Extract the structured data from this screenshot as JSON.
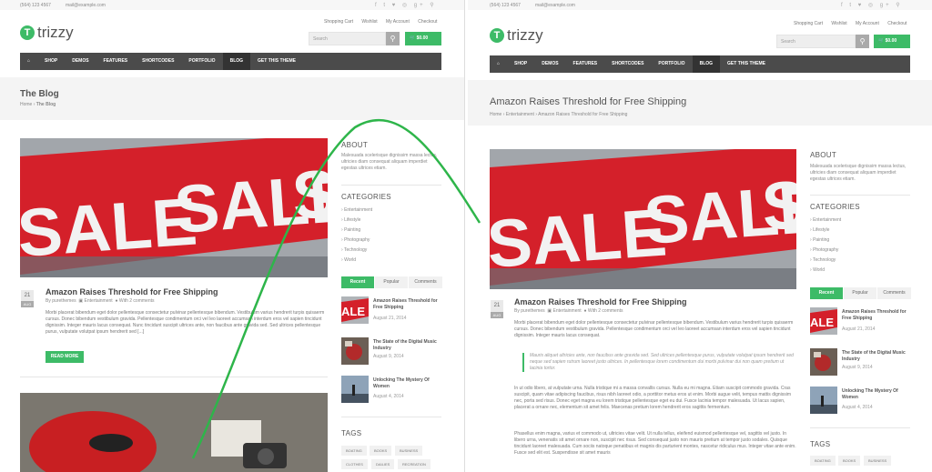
{
  "topbar": {
    "phone": "(564) 123 4567",
    "email": "mail@example.com",
    "social": "f t ♥ ◎ g+ ⚲"
  },
  "usermenu": {
    "cart": "Shopping Cart",
    "wishlist": "Wishlist",
    "account": "My Account",
    "checkout": "Checkout"
  },
  "logo": {
    "mark": "T",
    "text": "trizzy"
  },
  "search": {
    "placeholder": "Search",
    "icon": "magnifier-icon"
  },
  "cart_total": "$0.00",
  "nav": [
    "⌂",
    "SHOP",
    "DEMOS",
    "FEATURES",
    "SHORTCODES",
    "PORTFOLIO",
    "BLOG",
    "GET THIS THEME"
  ],
  "left": {
    "title": "The Blog",
    "crumb_home": "Home",
    "crumb_sep": "›",
    "crumb_current": "The Blog",
    "post": {
      "day": "21",
      "month": "AUG",
      "title": "Amazon Raises Threshold for Free Shipping",
      "author": "By purethemes",
      "category": "Entertainment",
      "comments": "With 2 comments",
      "excerpt": "Morbi placerat bibendum eget dolor pellentesque consectetur pulvinar pellentesque bibendum. Vestibulum varius hendrerit turpis quisaerm cursus. Donec bibendum vestibulum gravida. Pellentesque condimentum orci vel leo laoreet accumsan interdum eros vel sapien tincidunt dignissim. Integer mauris lacus consequat. Nunc tincidunt suscipit ultrices ante, non faucibus ante gravida sed. Sed ultrices pellentesque purus, vulputate volutpat ipsum hendrerit sed [...]",
      "read_more": "READ MORE"
    }
  },
  "right": {
    "title": "Amazon Raises Threshold for Free Shipping",
    "crumb_home": "Home",
    "crumb_sep": "›",
    "crumb_mid": "Entertainment",
    "crumb_current": "Amazon Raises Threshold for Free Shipping",
    "post": {
      "day": "21",
      "month": "AUG",
      "title": "Amazon Raises Threshold for Free Shipping",
      "author": "By purethemes",
      "category": "Entertainment",
      "comments": "With 2 comments",
      "p1": "Morbi placerat bibendum eget dolor pellentesque consectetur pulvinar pellentesque bibendum. Vestibulum varius hendrerit turpis quisaerm cursus. Donec bibendum vestibulum gravida. Pellentesque condimentum orci vel leo laoreet accumsan interdum eros vel sapien tincidunt dignissim. Integer mauris lacus consequat.",
      "quote": "Mauris aliquet ultricies ante, non faucibus ante gravida sed. Sed ultrices pellentesque purus, vulputate volutpat ipsum hendrerit sed neque sed sapien rutrum laoreet justo ultrices. In pellentesque lorem condimentum dui morbi pulvinar dui non quam pretium ut lacinia tortor.",
      "p2": "In ut odio libero, at vulputate urna. Nulla tristique mi a massa convallis cursus. Nulla eu mi magna. Etiam suscipit commodo gravida. Cras suscipit, quam vitae adipiscing faucibus, risus nibh laoreet odio, a porttitor metus eros ut enim. Morbi augue velit, tempus mattis dignissim nec, porta sed risus. Donec eget magna eu lorem tristique pellentesque eget eu dui. Fusce lacinia tempor malesuada. Ut lacus sapien, placerat a ornare nec, elementum sit amet felis. Maecenas pretium lorem hendrerit eros sagittis fermentum.",
      "p3": "Phasellus enim magna, varius et commodo ut, ultricies vitae velit. Ut nulla tellus, eleifend euismod pellentesque vel, sagittis vel justo. In libero urna, venenatis sit amet ornare non, suscipit nec risus. Sed consequat justo non mauris pretium at tempor justo sodales. Quisque tincidunt laoreet malesuada. Cum sociis natoque penatibus et magnis dis parturient montes, nascetur ridiculus mus. Integer vitae ante enim. Fusce sed elit est. Suspendisse sit amet mauris"
    }
  },
  "sidebar": {
    "about_title": "ABOUT",
    "about_text": "Malesuada scelerisque dignissim massa lectus, ultricies diam consequat aliquam imperdiet egestas ultrices etiam.",
    "cat_title": "CATEGORIES",
    "categories": [
      "Entertainment",
      "Lifestyle",
      "Painting",
      "Photography",
      "Technology",
      "World"
    ],
    "tabs": [
      "Recent",
      "Popular",
      "Comments"
    ],
    "recent": [
      {
        "title": "Amazon Raises Threshold for Free Shipping",
        "date": "August 21, 2014"
      },
      {
        "title": "The State of the Digital Music Industry",
        "date": "August 9, 2014"
      },
      {
        "title": "Unlocking The Mystery Of Women",
        "date": "August 4, 2014"
      }
    ],
    "tags_title": "TAGS",
    "tags": [
      "BOATING",
      "BOOKS",
      "BUSINESS",
      "CLOTHES",
      "DAILIES",
      "RECREATION"
    ]
  },
  "colors": {
    "accent": "#3dbb67",
    "nav": "#4b4b4b",
    "sale_red": "#d4202a"
  }
}
